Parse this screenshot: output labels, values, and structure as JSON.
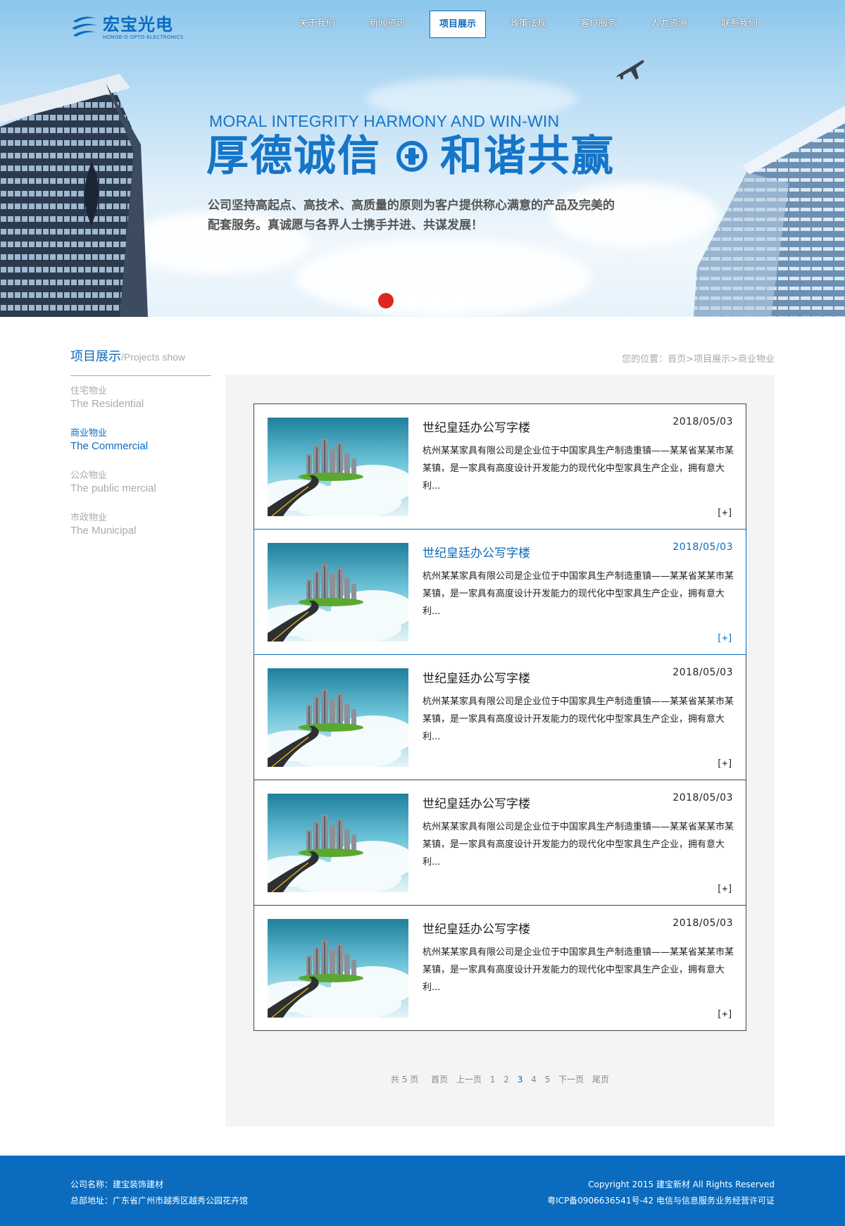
{
  "header": {
    "logo_cn": "宏宝光电",
    "logo_en": "HONGB·O OPTO-ELECTRONICS",
    "nav": [
      {
        "label": "关于我们"
      },
      {
        "label": "新闻资讯"
      },
      {
        "label": "项目展示",
        "active": true
      },
      {
        "label": "政策法规"
      },
      {
        "label": "客户服务"
      },
      {
        "label": "人力资源"
      },
      {
        "label": "联系我们"
      }
    ]
  },
  "banner": {
    "slogan_en": "MORAL INTEGRITY HARMONY AND WIN-WIN",
    "slogan_cn_left": "厚德诚信",
    "slogan_cn_right": "和谐共赢",
    "desc_line1": "公司坚持高起点、高技术、高质量的原则为客户提供称心满意的产品及完美的",
    "desc_line2": "配套服务。真诚愿与各界人士携手并进、共谋发展！",
    "slides": 4,
    "active_slide": 1
  },
  "sidebar": {
    "title": "项目展示",
    "subtitle": "/Projects show",
    "items": [
      {
        "cn": "住宅物业",
        "en": "The Residential"
      },
      {
        "cn": "商业物业",
        "en": "The Commercial",
        "active": true
      },
      {
        "cn": "公众物业",
        "en": "The public mercial"
      },
      {
        "cn": "市政物业",
        "en": "The Municipal"
      }
    ]
  },
  "breadcrumb": {
    "prefix": "您的位置：",
    "home": "首页",
    "sep": ">",
    "section": "项目展示",
    "current": "商业物业"
  },
  "projects": [
    {
      "title": "世纪皇廷办公写字楼",
      "date": "2018/05/03",
      "desc": "杭州某某家具有限公司是企业位于中国家具生产制造重镇——某某省某某市某某镇，是一家具有高度设计开发能力的现代化中型家具生产企业，拥有意大利...",
      "more": "[+]"
    },
    {
      "title": "世纪皇廷办公写字楼",
      "date": "2018/05/03",
      "desc": "杭州某某家具有限公司是企业位于中国家具生产制造重镇——某某省某某市某某镇，是一家具有高度设计开发能力的现代化中型家具生产企业，拥有意大利...",
      "more": "[+]",
      "highlight": true
    },
    {
      "title": "世纪皇廷办公写字楼",
      "date": "2018/05/03",
      "desc": "杭州某某家具有限公司是企业位于中国家具生产制造重镇——某某省某某市某某镇，是一家具有高度设计开发能力的现代化中型家具生产企业，拥有意大利...",
      "more": "[+]"
    },
    {
      "title": "世纪皇廷办公写字楼",
      "date": "2018/05/03",
      "desc": "杭州某某家具有限公司是企业位于中国家具生产制造重镇——某某省某某市某某镇，是一家具有高度设计开发能力的现代化中型家具生产企业，拥有意大利...",
      "more": "[+]"
    },
    {
      "title": "世纪皇廷办公写字楼",
      "date": "2018/05/03",
      "desc": "杭州某某家具有限公司是企业位于中国家具生产制造重镇——某某省某某市某某镇，是一家具有高度设计开发能力的现代化中型家具生产企业，拥有意大利...",
      "more": "[+]"
    }
  ],
  "pagination": {
    "info": "共 5 页",
    "first": "首页",
    "prev": "上一页",
    "pages": [
      "1",
      "2",
      "3",
      "4",
      "5"
    ],
    "current": "3",
    "next": "下一页",
    "last": "尾页"
  },
  "footer": {
    "company": "公司名称：建宝装饰建材",
    "address": "总部地址：广东省广州市越秀区越秀公园花卉馆",
    "copyright": "Copyright 2015 建宝新材 All Rights Reserved",
    "icp": "粤ICP备0906636541号-42  电信与信息服务业务经营许可证"
  },
  "colors": {
    "brand_blue": "#0a6bbf",
    "active_dot": "#e0271d",
    "panel_bg": "#f4f4f4"
  }
}
